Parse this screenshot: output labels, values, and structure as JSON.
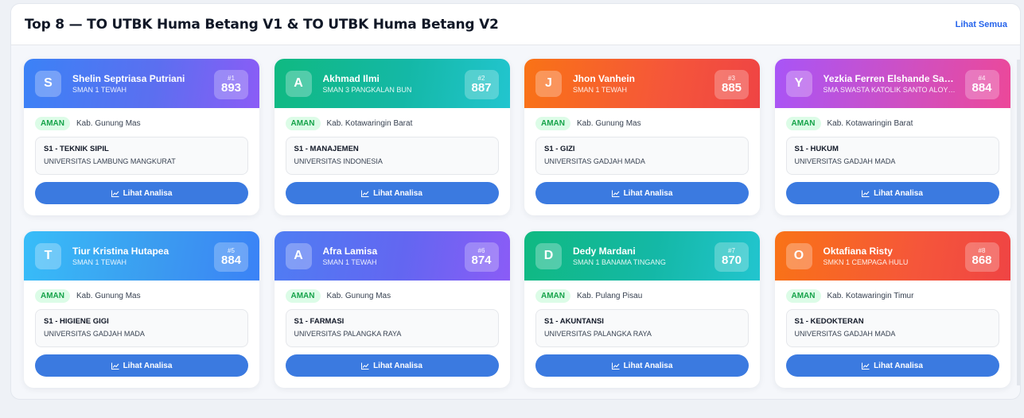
{
  "header": {
    "title": "Top 8 — TO UTBK Huma Betang V1 & TO UTBK Huma Betang V2",
    "see_all": "Lihat Semua"
  },
  "cards": [
    {
      "initial": "S",
      "name": "Shelin Septriasa Putriani",
      "school": "SMAN 1 TEWAH",
      "rank": "#1",
      "score": "893",
      "status": "AMAN",
      "region": "Kab. Gunung Mas",
      "major": "S1 - TEKNIK SIPIL",
      "university": "UNIVERSITAS LAMBUNG MANGKURAT",
      "button": "Lihat Analisa",
      "theme": "blue"
    },
    {
      "initial": "A",
      "name": "Akhmad Ilmi",
      "school": "SMAN 3 PANGKALAN BUN",
      "rank": "#2",
      "score": "887",
      "status": "AMAN",
      "region": "Kab. Kotawaringin Barat",
      "major": "S1 - MANAJEMEN",
      "university": "UNIVERSITAS INDONESIA",
      "button": "Lihat Analisa",
      "theme": "teal"
    },
    {
      "initial": "J",
      "name": "Jhon Vanhein",
      "school": "SMAN 1 TEWAH",
      "rank": "#3",
      "score": "885",
      "status": "AMAN",
      "region": "Kab. Gunung Mas",
      "major": "S1 - GIZI",
      "university": "UNIVERSITAS GADJAH MADA",
      "button": "Lihat Analisa",
      "theme": "orange"
    },
    {
      "initial": "Y",
      "name": "Yezkia Ferren Elshande Sanjaya",
      "school": "SMA SWASTA KATOLIK SANTO ALOYSIUS",
      "rank": "#4",
      "score": "884",
      "status": "AMAN",
      "region": "Kab. Kotawaringin Barat",
      "major": "S1 - HUKUM",
      "university": "UNIVERSITAS GADJAH MADA",
      "button": "Lihat Analisa",
      "theme": "purple"
    },
    {
      "initial": "T",
      "name": "Tiur Kristina Hutapea",
      "school": "SMAN 1 TEWAH",
      "rank": "#5",
      "score": "884",
      "status": "AMAN",
      "region": "Kab. Gunung Mas",
      "major": "S1 - HIGIENE GIGI",
      "university": "UNIVERSITAS GADJAH MADA",
      "button": "Lihat Analisa",
      "theme": "sky"
    },
    {
      "initial": "A",
      "name": "Afra Lamisa",
      "school": "SMAN 1 TEWAH",
      "rank": "#6",
      "score": "874",
      "status": "AMAN",
      "region": "Kab. Gunung Mas",
      "major": "S1 - FARMASI",
      "university": "UNIVERSITAS PALANGKA RAYA",
      "button": "Lihat Analisa",
      "theme": "indigo"
    },
    {
      "initial": "D",
      "name": "Dedy Mardani",
      "school": "SMAN 1 BANAMA TINGANG",
      "rank": "#7",
      "score": "870",
      "status": "AMAN",
      "region": "Kab. Pulang Pisau",
      "major": "S1 - AKUNTANSI",
      "university": "UNIVERSITAS PALANGKA RAYA",
      "button": "Lihat Analisa",
      "theme": "teal"
    },
    {
      "initial": "O",
      "name": "Oktafiana Risty",
      "school": "SMKN 1 CEMPAGA HULU",
      "rank": "#8",
      "score": "868",
      "status": "AMAN",
      "region": "Kab. Kotawaringin Timur",
      "major": "S1 - KEDOKTERAN",
      "university": "UNIVERSITAS GADJAH MADA",
      "button": "Lihat Analisa",
      "theme": "orange"
    }
  ],
  "colors": {
    "accent": "#3b7ae0",
    "badge_bg": "#dcfce7",
    "badge_text": "#16a34a"
  }
}
